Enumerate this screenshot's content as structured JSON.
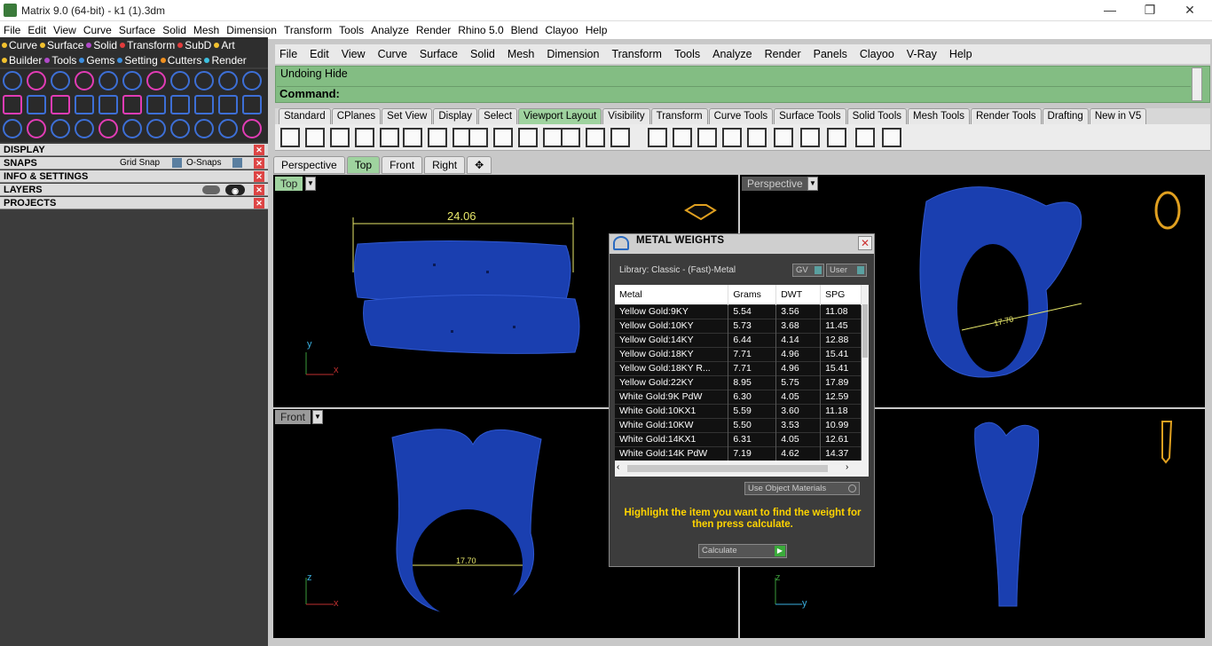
{
  "window": {
    "title": "Matrix 9.0 (64-bit) - k1 (1).3dm",
    "min": "—",
    "max": "❐",
    "close": "✕"
  },
  "outer_menu": [
    "File",
    "Edit",
    "View",
    "Curve",
    "Surface",
    "Solid",
    "Mesh",
    "Dimension",
    "Transform",
    "Tools",
    "Analyze",
    "Render",
    "Rhino 5.0",
    "Blend",
    "Clayoo",
    "Help"
  ],
  "matrix_tabs_row1": [
    {
      "label": "Curve",
      "color": "#f2c12e"
    },
    {
      "label": "Surface",
      "color": "#f2c12e"
    },
    {
      "label": "Solid",
      "color": "#b04ac9"
    },
    {
      "label": "Transform",
      "color": "#e23c3c"
    },
    {
      "label": "SubD",
      "color": "#e23c3c"
    },
    {
      "label": "Art",
      "color": "#f2c12e"
    }
  ],
  "matrix_tabs_row2": [
    {
      "label": "Builder",
      "color": "#f2c12e"
    },
    {
      "label": "Tools",
      "color": "#b04ac9"
    },
    {
      "label": "Gems",
      "color": "#3d8fe0"
    },
    {
      "label": "Setting",
      "color": "#3d8fe0"
    },
    {
      "label": "Cutters",
      "color": "#f09020"
    },
    {
      "label": "Render",
      "color": "#3dc0e0"
    }
  ],
  "sections": {
    "display": "DISPLAY",
    "snaps": "SNAPS",
    "grid_snap": "Grid Snap",
    "o_snaps": "O-Snaps",
    "info": "INFO & SETTINGS",
    "layers": "LAYERS",
    "projects": "PROJECTS"
  },
  "rhino_menu": [
    "File",
    "Edit",
    "View",
    "Curve",
    "Surface",
    "Solid",
    "Mesh",
    "Dimension",
    "Transform",
    "Tools",
    "Analyze",
    "Render",
    "Panels",
    "Clayoo",
    "V-Ray",
    "Help"
  ],
  "command": {
    "history": "Undoing Hide",
    "label": "Command:"
  },
  "toolbar_tabs": [
    "Standard",
    "CPlanes",
    "Set View",
    "Display",
    "Select",
    "Viewport Layout",
    "Visibility",
    "Transform",
    "Curve Tools",
    "Surface Tools",
    "Solid Tools",
    "Mesh Tools",
    "Render Tools",
    "Drafting",
    "New in V5"
  ],
  "active_toolbar_tab": "Viewport Layout",
  "viewport_tabs": [
    "Perspective",
    "Top",
    "Front",
    "Right",
    "✥"
  ],
  "viewports": {
    "top": "Top",
    "perspective": "Perspective",
    "front": "Front"
  },
  "dims": {
    "top_width": "24.06",
    "front_inner": "17.70",
    "persp_inner": "17.70"
  },
  "axes": {
    "x": "x",
    "y": "y",
    "z": "z"
  },
  "dialog": {
    "title": "METAL WEIGHTS",
    "library": "Library: Classic - (Fast)-Metal",
    "gv": "GV",
    "user": "User",
    "columns": [
      "Metal",
      "Grams",
      "DWT",
      "SPG"
    ],
    "rows": [
      [
        "Yellow Gold:9KY",
        "5.54",
        "3.56",
        "11.08"
      ],
      [
        "Yellow Gold:10KY",
        "5.73",
        "3.68",
        "11.45"
      ],
      [
        "Yellow Gold:14KY",
        "6.44",
        "4.14",
        "12.88"
      ],
      [
        "Yellow Gold:18KY",
        "7.71",
        "4.96",
        "15.41"
      ],
      [
        "Yellow Gold:18KY R...",
        "7.71",
        "4.96",
        "15.41"
      ],
      [
        "Yellow Gold:22KY",
        "8.95",
        "5.75",
        "17.89"
      ],
      [
        "White Gold:9K PdW",
        "6.30",
        "4.05",
        "12.59"
      ],
      [
        "White Gold:10KX1",
        "5.59",
        "3.60",
        "11.18"
      ],
      [
        "White Gold:10KW",
        "5.50",
        "3.53",
        "10.99"
      ],
      [
        "White Gold:14KX1",
        "6.31",
        "4.05",
        "12.61"
      ],
      [
        "White Gold:14K PdW",
        "7.19",
        "4.62",
        "14.37"
      ]
    ],
    "use_object_materials": "Use Object Materials",
    "hint": "Highlight the item you want to find the weight for then press calculate.",
    "calculate": "Calculate"
  },
  "colors": {
    "model": "#1a3fb0",
    "dim": "#e8e86a",
    "cmd_bg": "#83bd83",
    "tab_active": "#9fd39f"
  }
}
